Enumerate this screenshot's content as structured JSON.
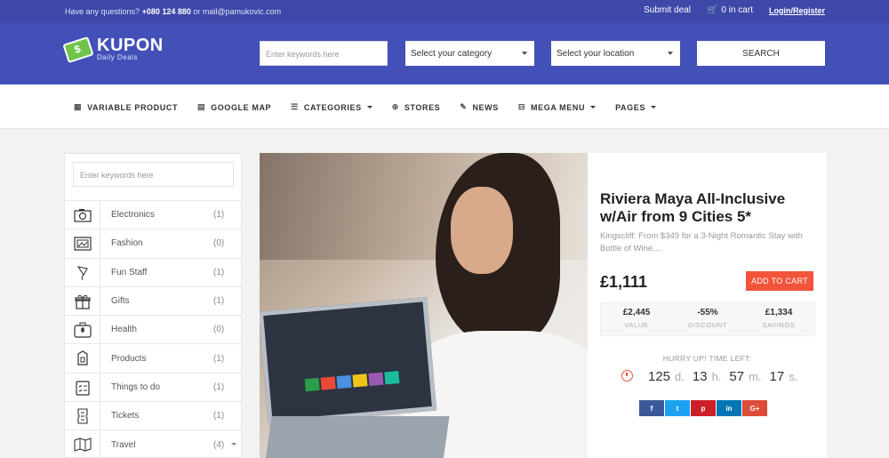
{
  "topbar": {
    "contact_prefix": "Have any questions?",
    "phone": "+080 124 880",
    "contact_mid": "or mail@pamukovic.com",
    "submit_deal": "Submit deal",
    "cart": "0 in cart",
    "login": "Login/Register"
  },
  "logo": {
    "name": "KUPON",
    "tagline": "Daily Deals"
  },
  "header_search": {
    "placeholder": "Enter keywords here",
    "category": "Select your category",
    "location": "Select your location",
    "button": "SEARCH"
  },
  "nav": {
    "items": [
      {
        "label": "VARIABLE PRODUCT",
        "icon": "grid-icon"
      },
      {
        "label": "GOOGLE MAP",
        "icon": "map-icon"
      },
      {
        "label": "CATEGORIES",
        "icon": "list-icon"
      },
      {
        "label": "STORES",
        "icon": "globe-icon"
      },
      {
        "label": "NEWS",
        "icon": "pencil-icon"
      },
      {
        "label": "MEGA MENU",
        "icon": "menu-icon"
      },
      {
        "label": "PAGES",
        "icon": ""
      }
    ]
  },
  "sidebar": {
    "placeholder": "Enter keywords here",
    "categories": [
      {
        "label": "Electronics",
        "count": "(1)",
        "icon": "camera-icon"
      },
      {
        "label": "Fashion",
        "count": "(0)",
        "icon": "picture-icon"
      },
      {
        "label": "Fun Staff",
        "count": "(1)",
        "icon": "kite-icon"
      },
      {
        "label": "Gifts",
        "count": "(1)",
        "icon": "gift-icon"
      },
      {
        "label": "Health",
        "count": "(0)",
        "icon": "medkit-icon"
      },
      {
        "label": "Products",
        "count": "(1)",
        "icon": "box-icon"
      },
      {
        "label": "Things to do",
        "count": "(1)",
        "icon": "checklist-icon"
      },
      {
        "label": "Tickets",
        "count": "(1)",
        "icon": "ticket-icon"
      },
      {
        "label": "Travel",
        "count": "(4)",
        "icon": "map-fold-icon"
      }
    ]
  },
  "deal": {
    "title": "Riviera Maya All-Inclusive w/Air from 9 Cities 5*",
    "description": "Kingscliff: From $349 for a 3-Night Romantic Stay with Bottle of Wine....",
    "price": "£1,111",
    "add_to_cart": "ADD TO CART",
    "stats": [
      {
        "value": "£2,445",
        "label": "VALUE"
      },
      {
        "value": "-55%",
        "label": "DISCOUNT"
      },
      {
        "value": "£1,334",
        "label": "SAVINGS"
      }
    ],
    "hurry": "HURRY UP! TIME LEFT:",
    "timer": {
      "days": "125",
      "d": "d.",
      "hours": "13",
      "h": "h.",
      "minutes": "57",
      "m": "m.",
      "seconds": "17",
      "s": "s."
    },
    "social": [
      {
        "label": "f",
        "color": "#3b5998"
      },
      {
        "label": "t",
        "color": "#1da1f2"
      },
      {
        "label": "p",
        "color": "#cb2027"
      },
      {
        "label": "in",
        "color": "#0077b5"
      },
      {
        "label": "G+",
        "color": "#dd4b39"
      }
    ]
  },
  "colors": {
    "brand": "#4250b8",
    "topbar": "#3d48a8",
    "accent": "#f2543a"
  }
}
